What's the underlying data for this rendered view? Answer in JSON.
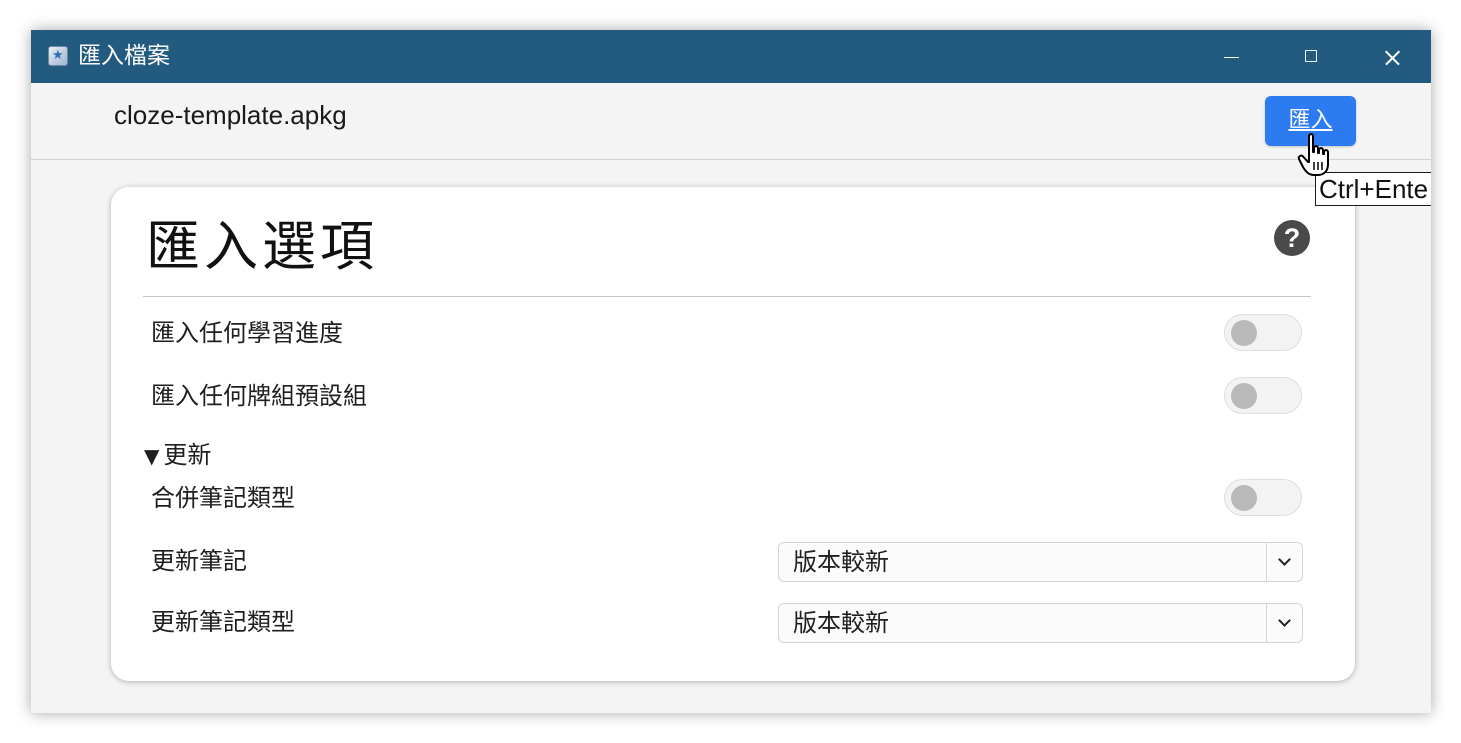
{
  "window": {
    "title": "匯入檔案",
    "icon": "anki-star-icon",
    "controls": [
      "minimize",
      "maximize",
      "close"
    ]
  },
  "topbar": {
    "filename": "cloze-template.apkg",
    "import_label": "匯入",
    "tooltip": "Ctrl+Ente"
  },
  "options": {
    "title": "匯入選項",
    "help_icon": "question-circle-icon",
    "import_progress": {
      "label": "匯入任何學習進度",
      "enabled": false
    },
    "import_presets": {
      "label": "匯入任何牌組預設組",
      "enabled": false
    },
    "update_section": {
      "header": "更新",
      "expanded": true,
      "merge_notetypes": {
        "label": "合併筆記類型",
        "enabled": false
      },
      "update_notes": {
        "label": "更新筆記",
        "value": "版本較新"
      },
      "update_notetypes": {
        "label": "更新筆記類型",
        "value": "版本較新"
      }
    }
  },
  "colors": {
    "titlebar": "#225a80",
    "accent": "#2d7bf0"
  }
}
